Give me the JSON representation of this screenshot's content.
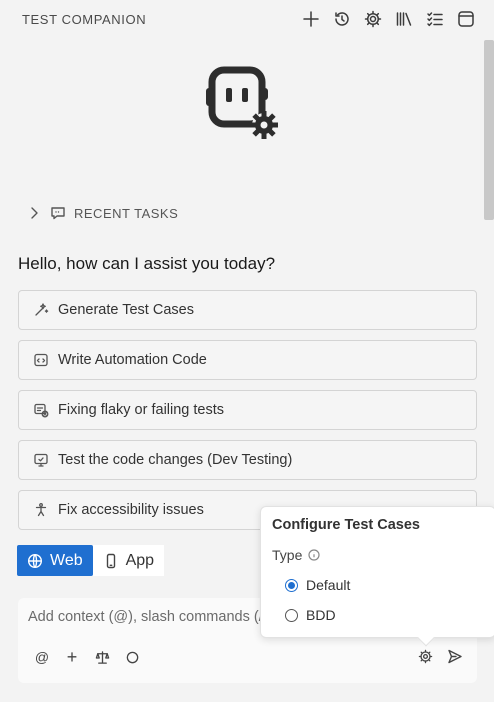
{
  "header": {
    "title": "TEST COMPANION",
    "actions": [
      "plus-icon",
      "history-icon",
      "gear-icon",
      "library-icon",
      "checklist-icon",
      "panel-icon"
    ]
  },
  "recent_tasks": {
    "label": "RECENT TASKS"
  },
  "greeting": "Hello, how can I assist you today?",
  "actions": [
    {
      "label": "Generate Test Cases",
      "icon": "magic-wand-icon"
    },
    {
      "label": "Write Automation Code",
      "icon": "code-edit-icon"
    },
    {
      "label": "Fixing flaky or failing tests",
      "icon": "fix-test-icon"
    },
    {
      "label": "Test the code changes (Dev Testing)",
      "icon": "dev-testing-icon"
    },
    {
      "label": "Fix accessibility issues",
      "icon": "accessibility-icon"
    }
  ],
  "mode": {
    "web_label": "Web",
    "app_label": "App",
    "selected": "Web"
  },
  "input": {
    "placeholder": "Add context (@), slash commands (/)",
    "value": ""
  },
  "tools": {
    "mention": "@",
    "add": "+"
  },
  "configure": {
    "title": "Configure Test Cases",
    "type_label": "Type",
    "options": [
      {
        "label": "Default",
        "checked": true
      },
      {
        "label": "BDD",
        "checked": false
      }
    ]
  },
  "colors": {
    "accent": "#1f6fd0",
    "background": "#f3f3f3"
  }
}
